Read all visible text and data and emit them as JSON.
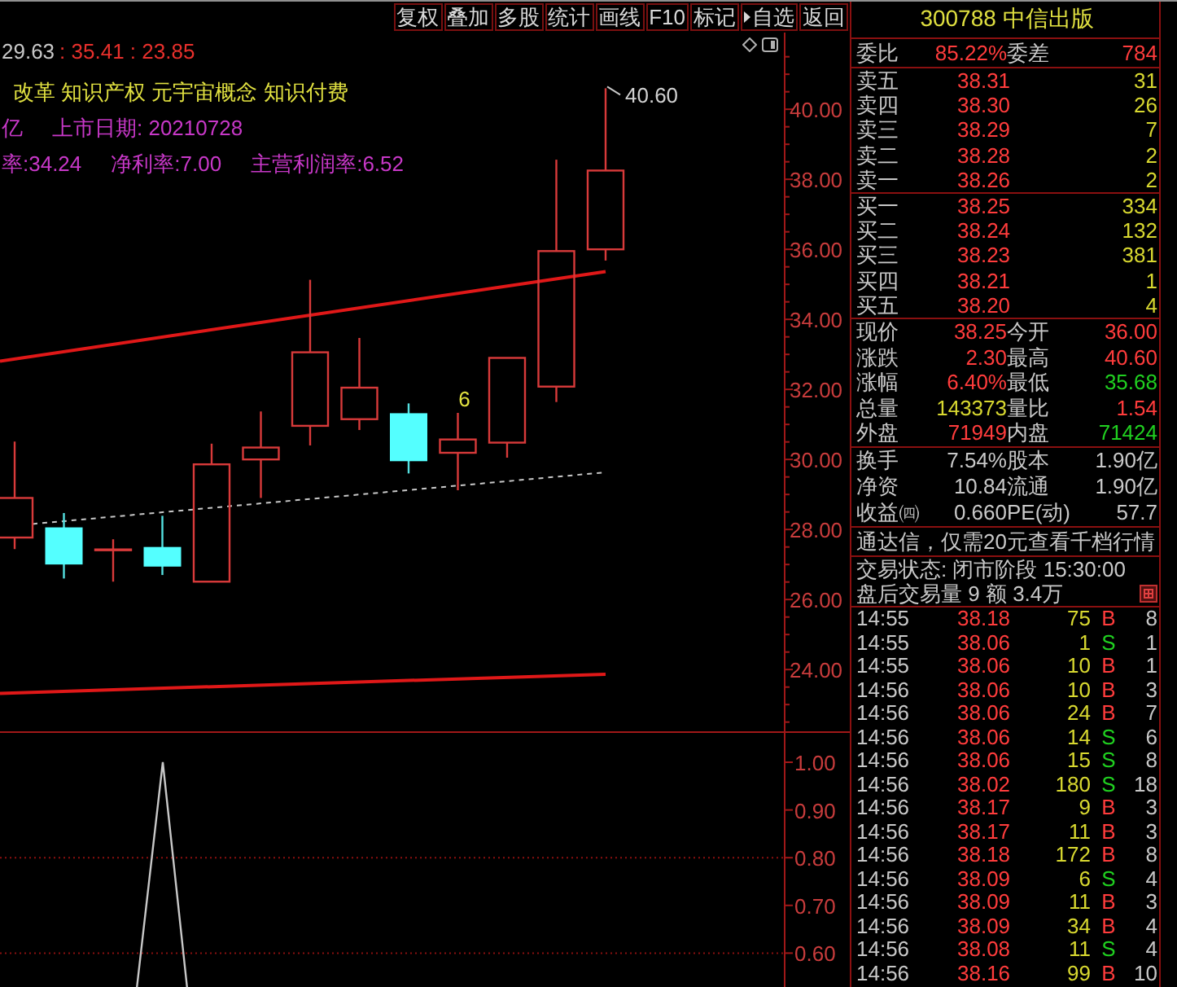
{
  "toolbar": {
    "buttons": [
      {
        "label": "复权",
        "caret": false
      },
      {
        "label": "叠加",
        "caret": false
      },
      {
        "label": "多股",
        "caret": false
      },
      {
        "label": "统计",
        "caret": false
      },
      {
        "label": "画线",
        "caret": false
      },
      {
        "label": "F10",
        "caret": false
      },
      {
        "label": "标记",
        "caret": false
      },
      {
        "label": "自选",
        "caret": true
      },
      {
        "label": "返回",
        "caret": false
      }
    ]
  },
  "chart_header": {
    "channel_values": [
      {
        "text": "29.63",
        "color": "#c8c8c8"
      },
      {
        "text": ": 35.41 : 23.85",
        "color": "#e8302c"
      }
    ],
    "concepts": "改革 知识产权 元宇宙概念 知识付费",
    "listing": [
      "亿",
      "上市日期: 20210728"
    ],
    "ratios": [
      "率:34.24",
      "净利率:7.00",
      "主营利润率:6.52"
    ]
  },
  "price_chart": {
    "y_axis_labels": [
      "40.00",
      "38.00",
      "36.00",
      "34.00",
      "32.00",
      "30.00",
      "28.00",
      "26.00",
      "24.00"
    ],
    "high_label": "40.60",
    "signal_label": "6"
  },
  "indicator_chart": {
    "y_axis_labels": [
      "1.00",
      "0.90",
      "0.80",
      "0.70",
      "0.60"
    ]
  },
  "quote": {
    "title": "300788 中信出版",
    "ratio_row": [
      {
        "label": "委比",
        "value": "85.22%"
      },
      {
        "label": "委差",
        "value": "784"
      }
    ],
    "asks": [
      {
        "label": "卖五",
        "price": "38.31",
        "volume": "31"
      },
      {
        "label": "卖四",
        "price": "38.30",
        "volume": "26"
      },
      {
        "label": "卖三",
        "price": "38.29",
        "volume": "7"
      },
      {
        "label": "卖二",
        "price": "38.28",
        "volume": "2"
      },
      {
        "label": "卖一",
        "price": "38.26",
        "volume": "2"
      }
    ],
    "bids": [
      {
        "label": "买一",
        "price": "38.25",
        "volume": "334"
      },
      {
        "label": "买二",
        "price": "38.24",
        "volume": "132"
      },
      {
        "label": "买三",
        "price": "38.23",
        "volume": "381"
      },
      {
        "label": "买四",
        "price": "38.21",
        "volume": "1"
      },
      {
        "label": "买五",
        "price": "38.20",
        "volume": "4"
      }
    ],
    "stats": [
      {
        "label": "现价",
        "value": "38.25",
        "color": "#ff3c3c"
      },
      {
        "label": "今开",
        "value": "36.00",
        "color": "#ff3c3c"
      },
      {
        "label": "涨跌",
        "value": "2.30",
        "color": "#ff3c3c"
      },
      {
        "label": "最高",
        "value": "40.60",
        "color": "#ff3c3c"
      },
      {
        "label": "涨幅",
        "value": "6.40%",
        "color": "#ff3c3c"
      },
      {
        "label": "最低",
        "value": "35.68",
        "color": "#20d020"
      },
      {
        "label": "总量",
        "value": "143373",
        "color": "#d8d830"
      },
      {
        "label": "量比",
        "value": "1.54",
        "color": "#ff3c3c"
      },
      {
        "label": "外盘",
        "value": "71949",
        "color": "#ff3c3c"
      },
      {
        "label": "内盘",
        "value": "71424",
        "color": "#20d020"
      }
    ],
    "fundamentals": [
      {
        "label": "换手",
        "value": "7.54%"
      },
      {
        "label": "股本",
        "value": "1.90亿"
      },
      {
        "label": "净资",
        "value": "10.84"
      },
      {
        "label": "流通",
        "value": "1.90亿"
      },
      {
        "label": "收益㈣",
        "value": "0.660"
      },
      {
        "label": "PE(动)",
        "value": "57.7"
      }
    ],
    "promo": "通达信，仅需20元查看千档行情",
    "trading_state": "交易状态: 闭市阶段 15:30:00",
    "after_hours": "盘后交易量 9 额 3.4万",
    "trades": [
      {
        "time": "14:55",
        "price": "38.18",
        "volume": "75",
        "side": "B",
        "color": "#ff3c3c",
        "column_5": "8"
      },
      {
        "time": "14:55",
        "price": "38.06",
        "volume": "1",
        "side": "S",
        "color": "#20d020",
        "column_5": "1"
      },
      {
        "time": "14:55",
        "price": "38.06",
        "volume": "10",
        "side": "B",
        "color": "#ff3c3c",
        "column_5": "1"
      },
      {
        "time": "14:56",
        "price": "38.06",
        "volume": "10",
        "side": "B",
        "color": "#ff3c3c",
        "column_5": "3"
      },
      {
        "time": "14:56",
        "price": "38.06",
        "volume": "24",
        "side": "B",
        "color": "#ff3c3c",
        "column_5": "7"
      },
      {
        "time": "14:56",
        "price": "38.06",
        "volume": "14",
        "side": "S",
        "color": "#20d020",
        "column_5": "6"
      },
      {
        "time": "14:56",
        "price": "38.06",
        "volume": "15",
        "side": "S",
        "color": "#20d020",
        "column_5": "8"
      },
      {
        "time": "14:56",
        "price": "38.02",
        "volume": "180",
        "side": "S",
        "color": "#20d020",
        "column_5": "18"
      },
      {
        "time": "14:56",
        "price": "38.17",
        "volume": "9",
        "side": "B",
        "color": "#ff3c3c",
        "column_5": "3"
      },
      {
        "time": "14:56",
        "price": "38.17",
        "volume": "11",
        "side": "B",
        "color": "#ff3c3c",
        "column_5": "3"
      },
      {
        "time": "14:56",
        "price": "38.18",
        "volume": "172",
        "side": "B",
        "color": "#ff3c3c",
        "column_5": "8"
      },
      {
        "time": "14:56",
        "price": "38.09",
        "volume": "6",
        "side": "S",
        "color": "#20d020",
        "column_5": "4"
      },
      {
        "time": "14:56",
        "price": "38.09",
        "volume": "11",
        "side": "B",
        "color": "#ff3c3c",
        "column_5": "3"
      },
      {
        "time": "14:56",
        "price": "38.09",
        "volume": "34",
        "side": "B",
        "color": "#ff3c3c",
        "column_5": "4"
      },
      {
        "time": "14:56",
        "price": "38.08",
        "volume": "11",
        "side": "S",
        "color": "#20d020",
        "column_5": "4"
      },
      {
        "time": "14:56",
        "price": "38.16",
        "volume": "99",
        "side": "B",
        "color": "#ff3c3c",
        "column_5": "10"
      }
    ]
  }
}
